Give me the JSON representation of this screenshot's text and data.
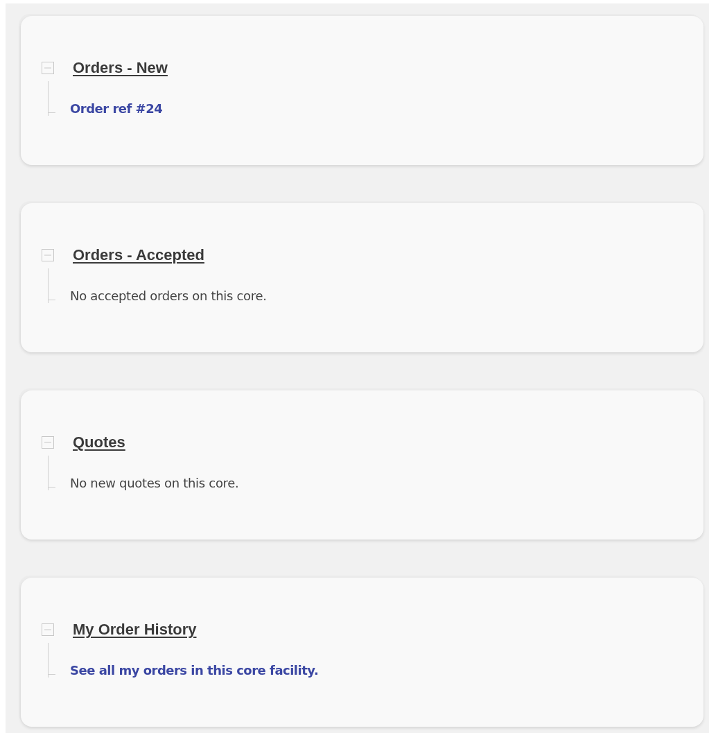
{
  "sections": [
    {
      "title": "Orders - New",
      "expanded": true,
      "items": [
        {
          "kind": "link",
          "text": "Order ref #24"
        }
      ]
    },
    {
      "title": "Orders - Accepted",
      "expanded": true,
      "items": [
        {
          "kind": "text",
          "text": "No accepted orders on this core."
        }
      ]
    },
    {
      "title": "Quotes",
      "expanded": true,
      "items": [
        {
          "kind": "text",
          "text": "No new quotes on this core."
        }
      ]
    },
    {
      "title": "My Order History",
      "expanded": true,
      "items": [
        {
          "kind": "link",
          "text": "See all my orders in this core facility."
        }
      ]
    }
  ]
}
